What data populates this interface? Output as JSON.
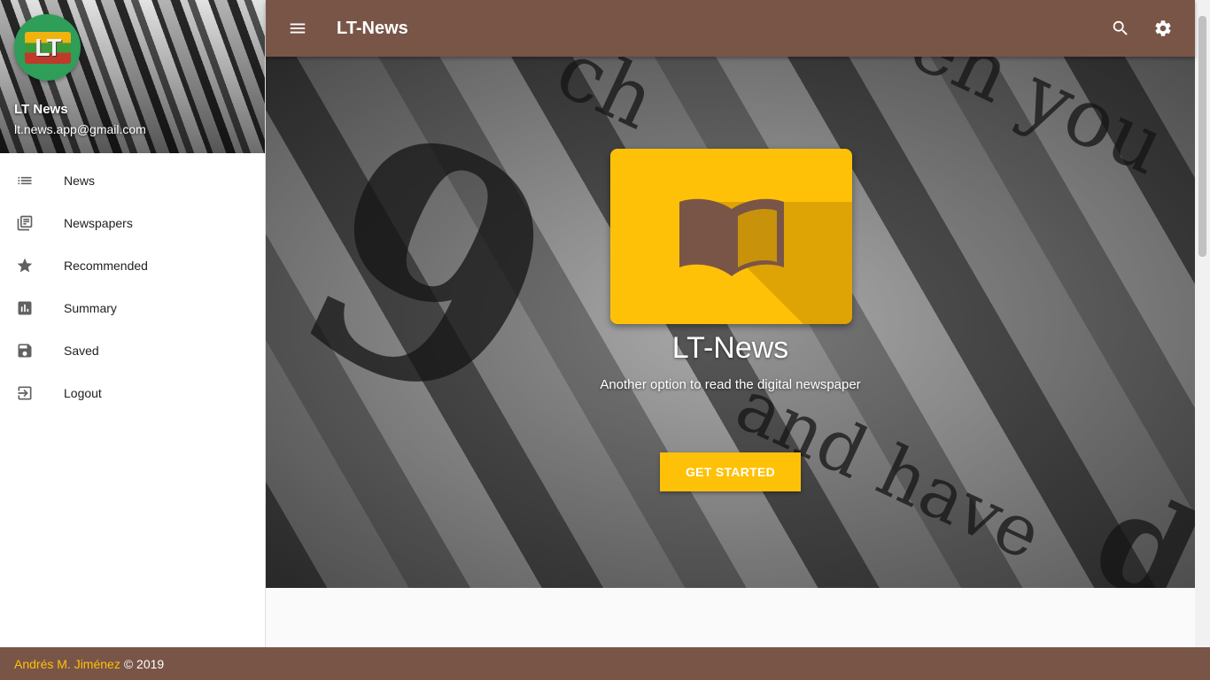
{
  "app": {
    "title": "LT-News"
  },
  "user": {
    "name": "LT News",
    "email": "lt.news.app@gmail.com",
    "avatar_text": "LT"
  },
  "sidebar": {
    "items": [
      {
        "label": "News",
        "icon": "list-icon"
      },
      {
        "label": "Newspapers",
        "icon": "library-books-icon"
      },
      {
        "label": "Recommended",
        "icon": "star-icon"
      },
      {
        "label": "Summary",
        "icon": "bar-chart-icon"
      },
      {
        "label": "Saved",
        "icon": "save-icon"
      },
      {
        "label": "Logout",
        "icon": "logout-icon"
      }
    ]
  },
  "toolbar": {
    "menu_icon": "menu-icon",
    "search_icon": "search-icon",
    "settings_icon": "gear-icon"
  },
  "hero": {
    "title": "LT-News",
    "subtitle": "Another option to read the digital newspaper",
    "cta_label": "GET STARTED",
    "logo_icon": "open-book-icon"
  },
  "footer": {
    "author": "Andrés M. Jiménez",
    "copyright": "© 2019"
  },
  "colors": {
    "primary": "#795548",
    "accent": "#ffc107",
    "avatar_bg": "#2e9e58"
  }
}
